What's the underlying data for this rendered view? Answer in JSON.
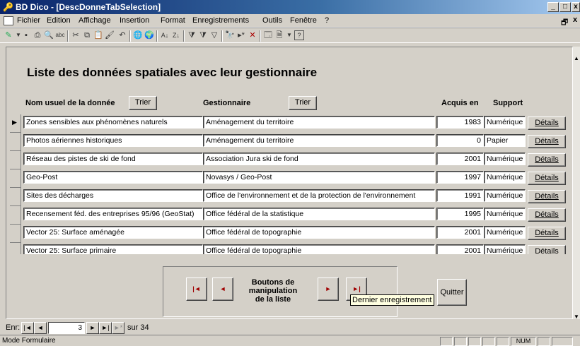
{
  "window": {
    "title": "BD Dico - [DescDonneTabSelection]"
  },
  "menu": [
    "Fichier",
    "Edition",
    "Affichage",
    "Insertion",
    "Format",
    "Enregistrements",
    "Outils",
    "Fenêtre",
    "?"
  ],
  "form": {
    "heading": "Liste des données spatiales avec leur gestionnaire",
    "col_nom": "Nom usuel de la donnée",
    "col_gest": "Gestionnaire",
    "col_acquis": "Acquis en",
    "col_support": "Support",
    "sort_label": "Trier",
    "details_label": "Détails"
  },
  "rows": [
    {
      "nom": "Zones sensibles aux phénomènes naturels",
      "gest": "Aménagement du territoire",
      "annee": "1983",
      "support": "Numérique"
    },
    {
      "nom": "Photos aériennes historiques",
      "gest": "Aménagement du territoire",
      "annee": "0",
      "support": "Papier"
    },
    {
      "nom": "Réseau des pistes de ski de fond",
      "gest": "Association Jura ski de fond",
      "annee": "2001",
      "support": "Numérique"
    },
    {
      "nom": "Geo-Post",
      "gest": "Novasys / Geo-Post",
      "annee": "1997",
      "support": "Numérique"
    },
    {
      "nom": "Sites des décharges",
      "gest": "Office de l'environnement et de la protection de l'environnement",
      "annee": "1991",
      "support": "Numérique"
    },
    {
      "nom": "Recensement féd. des entreprises 95/96 (GeoStat)",
      "gest": "Office fédéral de la statistique",
      "annee": "1995",
      "support": "Numérique"
    },
    {
      "nom": "Vector 25: Surface aménagée",
      "gest": "Office fédéral de topographie",
      "annee": "2001",
      "support": "Numérique"
    },
    {
      "nom": "Vector 25: Surface primaire",
      "gest": "Office fédéral de topographie",
      "annee": "2001",
      "support": "Numérique"
    }
  ],
  "nav": {
    "caption_line1": "Boutons de",
    "caption_line2": "manipulation",
    "caption_line3": "de la liste",
    "tooltip": "Dernier enregistrement",
    "quit_label": "Quitter"
  },
  "recordnav": {
    "label": "Enr:",
    "current": "3",
    "total_label": "sur 34"
  },
  "status": {
    "mode": "Mode Formulaire",
    "num": "NUM"
  }
}
